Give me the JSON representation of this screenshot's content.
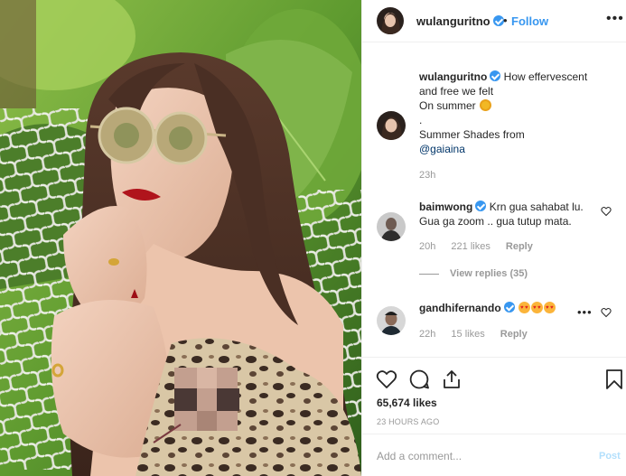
{
  "post": {
    "author": "wulanguritno",
    "follow_label": "Follow",
    "dot": "•",
    "more": "•••"
  },
  "caption": {
    "username": "wulanguritno",
    "line1": "How effervescent",
    "line2": "and free we felt",
    "line3": "On summer",
    "line4": ".",
    "line5": "Summer Shades from",
    "mention": "@gaiaina",
    "time": "23h"
  },
  "comments": [
    {
      "username": "baimwong",
      "text1": "Krn gua sahabat lu.",
      "text2": "Gua ga zoom .. gua tutup mata.",
      "time": "20h",
      "likes": "221 likes",
      "reply": "Reply",
      "view_replies": "View replies (35)"
    },
    {
      "username": "gandhifernando",
      "time": "22h",
      "likes": "15 likes",
      "reply": "Reply",
      "more": "•••"
    }
  ],
  "actions": {
    "likes": "65,674 likes",
    "timestamp": "23 HOURS AGO"
  },
  "add_comment": {
    "placeholder": "Add a comment...",
    "post_label": "Post"
  },
  "colors": {
    "accent": "#3897f0",
    "text": "#262626",
    "muted": "#999999",
    "post_disabled": "#b2dffc"
  },
  "icons": [
    "verified-badge-icon",
    "heart-icon",
    "comment-icon",
    "share-icon",
    "bookmark-icon",
    "more-icon"
  ]
}
